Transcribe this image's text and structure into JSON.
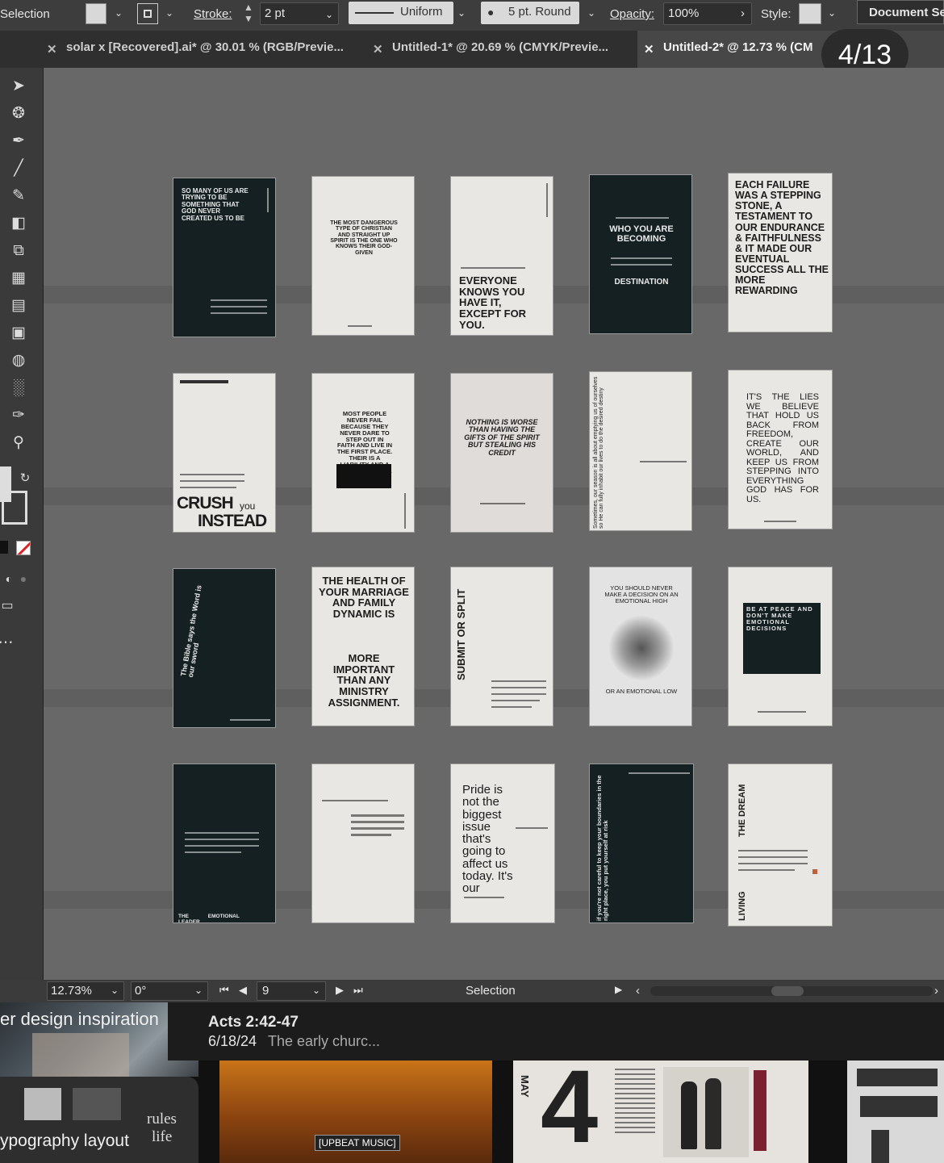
{
  "control_bar": {
    "tool_name": "Selection",
    "stroke_label": "Stroke:",
    "stroke_value": "2 pt",
    "profile": "Uniform",
    "brush": "5 pt. Round",
    "opacity_label": "Opacity:",
    "opacity_value": "100%",
    "style_label": "Style:",
    "doc_setup": "Document Se"
  },
  "tabs": [
    {
      "label": "solar x [Recovered].ai* @ 30.01 % (RGB/Previe..."
    },
    {
      "label": "Untitled-1* @ 20.69 % (CMYK/Previe..."
    },
    {
      "label": "Untitled-2* @ 12.73 % (CM"
    }
  ],
  "page_counter": "4/13",
  "artboards": [
    {
      "theme": "dark",
      "text": "SO MANY OF US ARE TRYING TO BE SOMETHING THAT GOD NEVER CREATED US TO BE"
    },
    {
      "theme": "light",
      "text": "THE MOST DANGEROUS TYPE OF CHRISTIAN AND STRAIGHT UP SPIRIT IS THE ONE WHO KNOWS THEIR GOD-GIVEN"
    },
    {
      "theme": "light",
      "text": "EVERYONE KNOWS YOU HAVE IT, EXCEPT FOR YOU."
    },
    {
      "theme": "dark",
      "text": "WHO YOU ARE BECOMING",
      "text2": "DESTINATION"
    },
    {
      "theme": "light",
      "text": "EACH FAILURE WAS A STEPPING STONE, A TESTAMENT TO OUR ENDURANCE & FAITHFULNESS & IT MADE OUR EVENTUAL SUCCESS ALL THE MORE REWARDING"
    },
    {
      "theme": "light",
      "text": "CRUSH",
      "text2": "you",
      "text3": "INSTEAD"
    },
    {
      "theme": "light",
      "text": "MOST PEOPLE NEVER FAIL BECAUSE THEY NEVER DARE TO STEP OUT IN FAITH AND LIVE IN THE FIRST PLACE. THEIR IS A LIABILITY AND A FAILURE ANYWAY."
    },
    {
      "theme": "light",
      "text": "NOTHING IS WORSE THAN HAVING THE GIFTS OF THE SPIRIT BUT STEALING HIS CREDIT"
    },
    {
      "theme": "light",
      "text": "Sometimes, our season is all about emptying us of ourselves so He can fully inhabit our lives to do the desired destiny"
    },
    {
      "theme": "light",
      "text": "IT'S THE LIES WE BELIEVE THAT HOLD US BACK FROM FREEDOM, CREATE OUR WORLD, AND KEEP US FROM STEPPING INTO EVERYTHING GOD HAS FOR US."
    },
    {
      "theme": "dark",
      "text": "The Bible says the Word is our sword"
    },
    {
      "theme": "light",
      "text": "THE HEALTH OF YOUR MARRIAGE AND FAMILY DYNAMIC IS",
      "text2": "MORE IMPORTANT THAN ANY MINISTRY ASSIGNMENT."
    },
    {
      "theme": "light",
      "text": "SUBMIT OR SPLIT"
    },
    {
      "theme": "light",
      "text": "YOU SHOULD NEVER MAKE A DECISION ON AN EMOTIONAL HIGH",
      "text2": "OR AN EMOTIONAL LOW"
    },
    {
      "theme": "light",
      "text": "BE AT PEACE AND DON'T MAKE EMOTIONAL DECISIONS"
    },
    {
      "theme": "dark",
      "text": "THE EMOTIONAL LEADER"
    },
    {
      "theme": "light",
      "text": ""
    },
    {
      "theme": "light",
      "text": "Pride is not the biggest issue that's going to affect us today. It's our"
    },
    {
      "theme": "dark",
      "text": "if you're not careful to keep your boundaries in the right place, you put yourself at risk"
    },
    {
      "theme": "light",
      "text": "THE DREAM",
      "text2": "LIVING"
    }
  ],
  "status_bar": {
    "zoom": "12.73%",
    "rotation": "0°",
    "artboard_number": "9",
    "tool": "Selection"
  },
  "bottom_panel": {
    "left_title": "er design inspiration",
    "sermon_title": "Acts 2:42-47",
    "sermon_date": "6/18/24",
    "sermon_desc": "The early churc...",
    "typography_label": "ypography layout",
    "rules_label": "rules",
    "life_label": "life",
    "music_tag": "[UPBEAT MUSIC]",
    "month": "MAY",
    "big_number": "4"
  }
}
